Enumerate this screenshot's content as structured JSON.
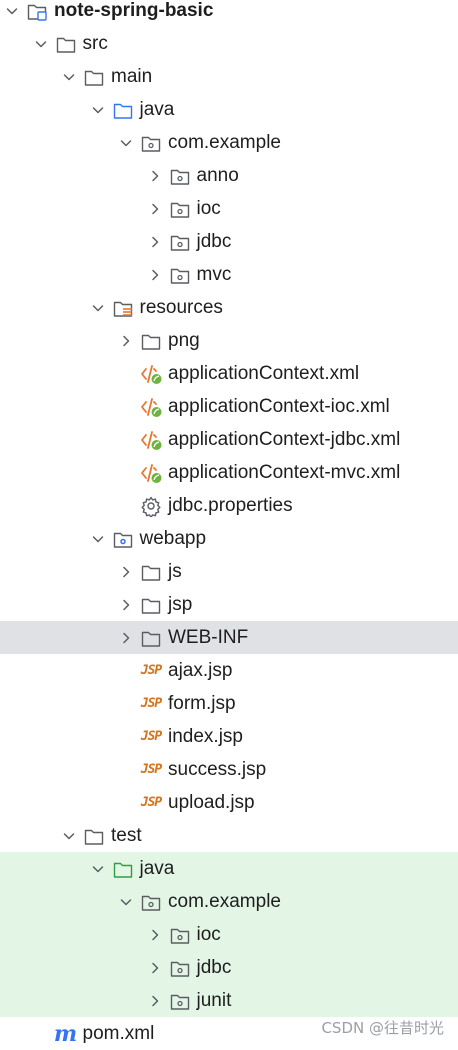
{
  "tree": [
    {
      "id": "project",
      "label": "note-spring-basic",
      "depth": 0,
      "expanded": true,
      "icon": "module-folder-icon",
      "bold": true
    },
    {
      "id": "src",
      "label": "src",
      "depth": 1,
      "expanded": true,
      "icon": "folder-icon"
    },
    {
      "id": "main",
      "label": "main",
      "depth": 2,
      "expanded": true,
      "icon": "folder-icon"
    },
    {
      "id": "java-main",
      "label": "java",
      "depth": 3,
      "expanded": true,
      "icon": "source-folder-icon"
    },
    {
      "id": "pkg-main",
      "label": "com.example",
      "depth": 4,
      "expanded": true,
      "icon": "package-icon"
    },
    {
      "id": "anno",
      "label": "anno",
      "depth": 5,
      "expanded": false,
      "icon": "package-icon"
    },
    {
      "id": "ioc",
      "label": "ioc",
      "depth": 5,
      "expanded": false,
      "icon": "package-icon"
    },
    {
      "id": "jdbc",
      "label": "jdbc",
      "depth": 5,
      "expanded": false,
      "icon": "package-icon"
    },
    {
      "id": "mvc",
      "label": "mvc",
      "depth": 5,
      "expanded": false,
      "icon": "package-icon"
    },
    {
      "id": "resources",
      "label": "resources",
      "depth": 3,
      "expanded": true,
      "icon": "resources-folder-icon"
    },
    {
      "id": "png",
      "label": "png",
      "depth": 4,
      "expanded": false,
      "icon": "folder-icon"
    },
    {
      "id": "appctx",
      "label": "applicationContext.xml",
      "depth": 4,
      "icon": "spring-xml-icon"
    },
    {
      "id": "appctx-ioc",
      "label": "applicationContext-ioc.xml",
      "depth": 4,
      "icon": "spring-xml-icon"
    },
    {
      "id": "appctx-jdbc",
      "label": "applicationContext-jdbc.xml",
      "depth": 4,
      "icon": "spring-xml-icon"
    },
    {
      "id": "appctx-mvc",
      "label": "applicationContext-mvc.xml",
      "depth": 4,
      "icon": "spring-xml-icon"
    },
    {
      "id": "jdbc-props",
      "label": "jdbc.properties",
      "depth": 4,
      "icon": "gear-icon"
    },
    {
      "id": "webapp",
      "label": "webapp",
      "depth": 3,
      "expanded": true,
      "icon": "web-folder-icon"
    },
    {
      "id": "js",
      "label": "js",
      "depth": 4,
      "expanded": false,
      "icon": "folder-icon"
    },
    {
      "id": "jsp",
      "label": "jsp",
      "depth": 4,
      "expanded": false,
      "icon": "folder-icon"
    },
    {
      "id": "webinf",
      "label": "WEB-INF",
      "depth": 4,
      "expanded": false,
      "icon": "folder-icon",
      "selected": true
    },
    {
      "id": "ajax",
      "label": "ajax.jsp",
      "depth": 4,
      "icon": "jsp-icon"
    },
    {
      "id": "form",
      "label": "form.jsp",
      "depth": 4,
      "icon": "jsp-icon"
    },
    {
      "id": "index",
      "label": "index.jsp",
      "depth": 4,
      "icon": "jsp-icon"
    },
    {
      "id": "success",
      "label": "success.jsp",
      "depth": 4,
      "icon": "jsp-icon"
    },
    {
      "id": "upload",
      "label": "upload.jsp",
      "depth": 4,
      "icon": "jsp-icon"
    },
    {
      "id": "test",
      "label": "test",
      "depth": 2,
      "expanded": true,
      "icon": "folder-icon"
    },
    {
      "id": "java-test",
      "label": "java",
      "depth": 3,
      "expanded": true,
      "icon": "test-source-folder-icon",
      "testbg": true
    },
    {
      "id": "pkg-test",
      "label": "com.example",
      "depth": 4,
      "expanded": true,
      "icon": "package-icon",
      "testbg": true
    },
    {
      "id": "ioc-test",
      "label": "ioc",
      "depth": 5,
      "expanded": false,
      "icon": "package-icon",
      "testbg": true
    },
    {
      "id": "jdbc-test",
      "label": "jdbc",
      "depth": 5,
      "expanded": false,
      "icon": "package-icon",
      "testbg": true
    },
    {
      "id": "junit",
      "label": "junit",
      "depth": 5,
      "expanded": false,
      "icon": "package-icon",
      "testbg": true
    },
    {
      "id": "pom",
      "label": "pom.xml",
      "depth": 1,
      "icon": "maven-icon"
    }
  ],
  "icon_text": {
    "jsp": "JSP",
    "maven": "m"
  },
  "watermark": "CSDN @往昔时光",
  "colors": {
    "selected": "#dfe1e5",
    "test_bg": "#e3f6e5",
    "spring": "#6db33f",
    "xml": "#e8762c",
    "source_folder": "#3574f0",
    "test_folder": "#2e9e46"
  }
}
